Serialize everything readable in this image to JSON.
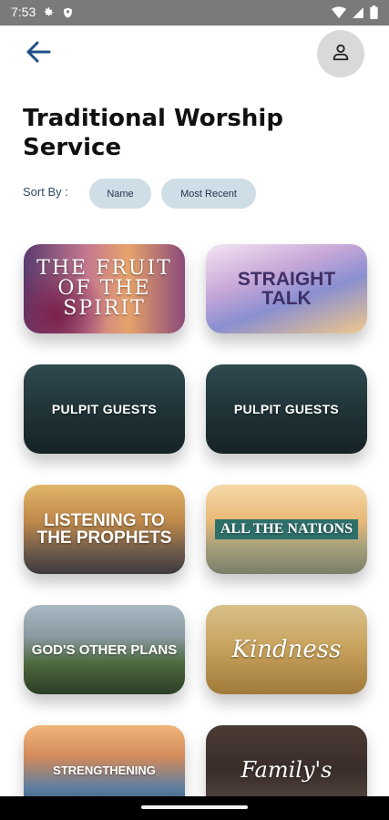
{
  "status_bar": {
    "time": "7:53",
    "icons": [
      "gear-icon",
      "shield-icon",
      "wifi-icon",
      "signal-icon",
      "battery-icon"
    ]
  },
  "header": {
    "back_icon": "arrow-left-icon",
    "profile_icon": "person-icon",
    "title": "Traditional Worship Service"
  },
  "sort": {
    "label": "Sort By :",
    "options": [
      "Name",
      "Most Recent"
    ]
  },
  "series": [
    {
      "title": "THE FRUIT OF THE SPIRIT"
    },
    {
      "title": "STRAIGHT TALK"
    },
    {
      "title": "PULPIT GUESTS"
    },
    {
      "title": "PULPIT GUESTS"
    },
    {
      "title": "LISTENING TO THE PROPHETS"
    },
    {
      "title": "ALL THE NATIONS"
    },
    {
      "title": "GOD'S OTHER PLANS"
    },
    {
      "title": "Kindness"
    },
    {
      "title": "STRENGTHENING"
    },
    {
      "title": "Family's"
    }
  ],
  "colors": {
    "accent": "#1f4f86",
    "chip_bg": "#cfdde6",
    "status_bar": "#7a7a7a"
  }
}
